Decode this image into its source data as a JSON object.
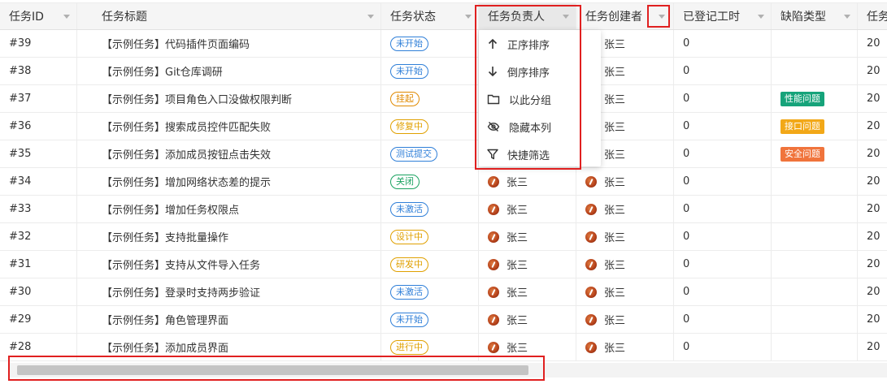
{
  "columns": [
    {
      "id": "task-id",
      "label": "任务ID"
    },
    {
      "id": "task-title",
      "label": "任务标题"
    },
    {
      "id": "task-status",
      "label": "任务状态"
    },
    {
      "id": "task-assignee",
      "label": "任务负责人"
    },
    {
      "id": "task-creator",
      "label": "任务创建者"
    },
    {
      "id": "logged-hours",
      "label": "已登记工时"
    },
    {
      "id": "defect-type",
      "label": "缺陷类型"
    },
    {
      "id": "next",
      "label": "任务"
    }
  ],
  "rows": [
    {
      "id": "#39",
      "title": "【示例任务】代码插件页面编码",
      "status": "未开始",
      "assignee": "",
      "creator": "张三",
      "hours": "0",
      "defect": "",
      "more": "20"
    },
    {
      "id": "#38",
      "title": "【示例任务】Git仓库调研",
      "status": "未开始",
      "assignee": "",
      "creator": "张三",
      "hours": "0",
      "defect": "",
      "more": "20"
    },
    {
      "id": "#37",
      "title": "【示例任务】项目角色入口没做权限判断",
      "status": "挂起",
      "assignee": "",
      "creator": "张三",
      "hours": "0",
      "defect": "性能问题",
      "more": "20"
    },
    {
      "id": "#36",
      "title": "【示例任务】搜索成员控件匹配失败",
      "status": "修复中",
      "assignee": "",
      "creator": "张三",
      "hours": "0",
      "defect": "接口问题",
      "more": "20"
    },
    {
      "id": "#35",
      "title": "【示例任务】添加成员按钮点击失效",
      "status": "测试提交",
      "assignee": "",
      "creator": "张三",
      "hours": "0",
      "defect": "安全问题",
      "more": "20"
    },
    {
      "id": "#34",
      "title": "【示例任务】增加网络状态差的提示",
      "status": "关闭",
      "assignee": "张三",
      "creator": "张三",
      "hours": "0",
      "defect": "",
      "more": "20"
    },
    {
      "id": "#33",
      "title": "【示例任务】增加任务权限点",
      "status": "未激活",
      "assignee": "张三",
      "creator": "张三",
      "hours": "0",
      "defect": "",
      "more": "20"
    },
    {
      "id": "#32",
      "title": "【示例任务】支持批量操作",
      "status": "设计中",
      "assignee": "张三",
      "creator": "张三",
      "hours": "0",
      "defect": "",
      "more": "20"
    },
    {
      "id": "#31",
      "title": "【示例任务】支持从文件导入任务",
      "status": "研发中",
      "assignee": "张三",
      "creator": "张三",
      "hours": "0",
      "defect": "",
      "more": "20"
    },
    {
      "id": "#30",
      "title": "【示例任务】登录时支持两步验证",
      "status": "未激活",
      "assignee": "张三",
      "creator": "张三",
      "hours": "0",
      "defect": "",
      "more": "20"
    },
    {
      "id": "#29",
      "title": "【示例任务】角色管理界面",
      "status": "未开始",
      "assignee": "张三",
      "creator": "张三",
      "hours": "0",
      "defect": "",
      "more": "20"
    },
    {
      "id": "#28",
      "title": "【示例任务】添加成员界面",
      "status": "进行中",
      "assignee": "张三",
      "creator": "张三",
      "hours": "0",
      "defect": "",
      "more": "20"
    }
  ],
  "status_colors": {
    "未开始": "#2f7fd8",
    "挂起": "#e08a00",
    "修复中": "#e0a000",
    "测试提交": "#2f7fd8",
    "关闭": "#1aa260",
    "未激活": "#2f7fd8",
    "设计中": "#e0a000",
    "研发中": "#e0a000",
    "进行中": "#e0a000"
  },
  "defect_colors": {
    "性能问题": "#16a37a",
    "接口问题": "#f2a818",
    "安全问题": "#f0743c"
  },
  "menu": [
    {
      "id": "sort-asc",
      "icon": "arrow-up-icon",
      "label": "正序排序"
    },
    {
      "id": "sort-desc",
      "icon": "arrow-down-icon",
      "label": "倒序排序"
    },
    {
      "id": "group-by",
      "icon": "group-icon",
      "label": "以此分组"
    },
    {
      "id": "hide-column",
      "icon": "eye-off-icon",
      "label": "隐藏本列"
    },
    {
      "id": "quick-filter",
      "icon": "filter-icon",
      "label": "快捷筛选"
    }
  ]
}
